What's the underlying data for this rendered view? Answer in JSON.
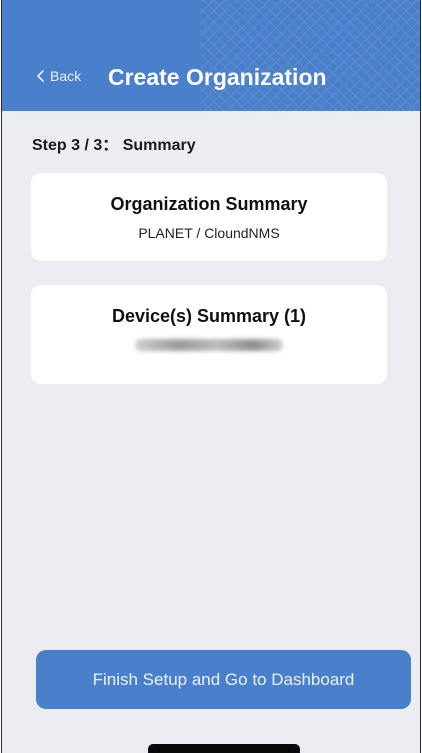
{
  "nav": {
    "back_label": "Back",
    "title": "Create Organization"
  },
  "step": {
    "label": "Step 3 / 3： Summary"
  },
  "organization_summary": {
    "title": "Organization Summary",
    "value": "PLANET / CloundNMS"
  },
  "device_summary": {
    "title": "Device(s) Summary (1)"
  },
  "actions": {
    "finish_label": "Finish Setup and Go to Dashboard"
  },
  "colors": {
    "accent": "#4a7fcb",
    "background": "#ebedf2",
    "card": "#ffffff"
  },
  "icons": {
    "back": "chevron-left-icon"
  }
}
